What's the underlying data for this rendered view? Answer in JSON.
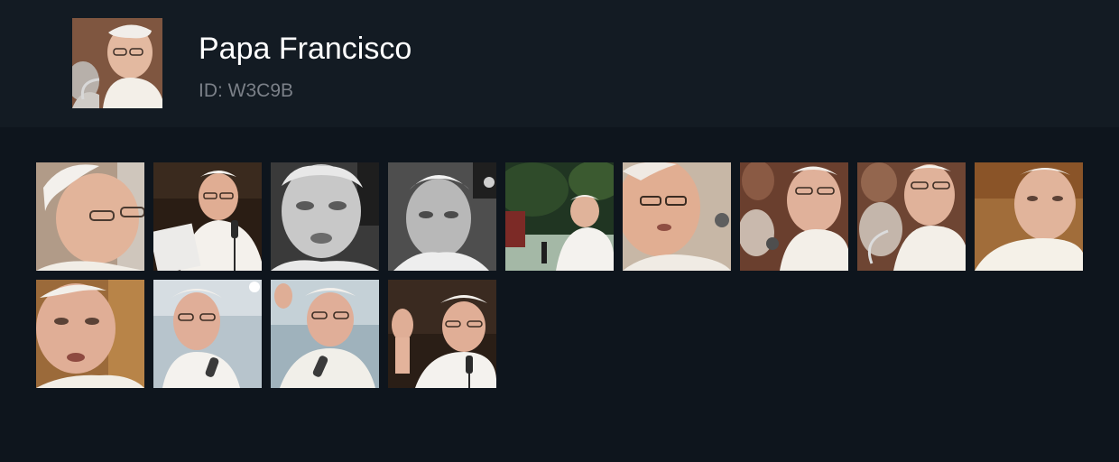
{
  "person": {
    "name": "Papa Francisco",
    "id_label": "ID: W3C9B"
  },
  "photos_count": 13,
  "palette": {
    "background": "#0e151d",
    "header": "#131b23",
    "title": "#ffffff",
    "id_text": "#7b8088"
  }
}
